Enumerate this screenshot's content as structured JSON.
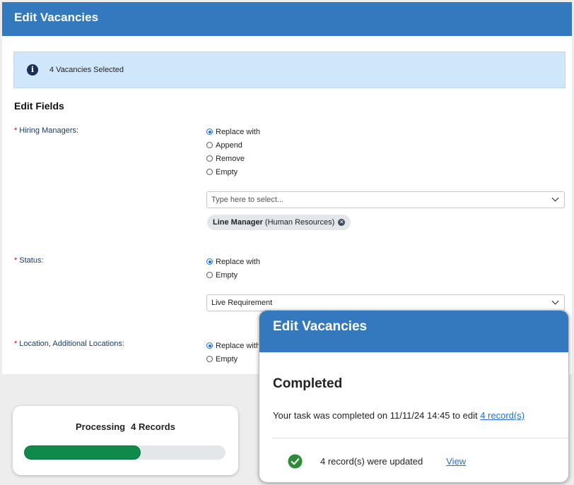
{
  "main": {
    "title": "Edit Vacancies",
    "info": "4 Vacancies Selected",
    "section_title": "Edit Fields",
    "hiring_managers": {
      "label": "Hiring Managers:",
      "options": [
        "Replace with",
        "Append",
        "Remove",
        "Empty"
      ],
      "selected": "Replace with",
      "select_placeholder": "Type here to select...",
      "tag_bold": "Line Manager",
      "tag_rest": "(Human Resources)"
    },
    "status": {
      "label": "Status:",
      "options": [
        "Replace with",
        "Empty"
      ],
      "selected": "Replace with",
      "value": "Live Requirement"
    },
    "location": {
      "label": "Location, Additional Locations:",
      "options": [
        "Replace with",
        "Empty"
      ],
      "selected": "Replace with"
    }
  },
  "processing": {
    "label": "Processing",
    "count": "4 Records",
    "progress": 0.58
  },
  "done": {
    "title": "Edit Vacancies",
    "heading": "Completed",
    "message": "Your task was completed on 11/11/24 14:45 to edit ",
    "records_link": "4 record(s)",
    "result": "4 record(s) were updated",
    "view_link": "View"
  },
  "colors": {
    "header": "#3479be",
    "progress": "#0f8a4a",
    "link": "#1e6fd9",
    "required": "#d0021b"
  }
}
